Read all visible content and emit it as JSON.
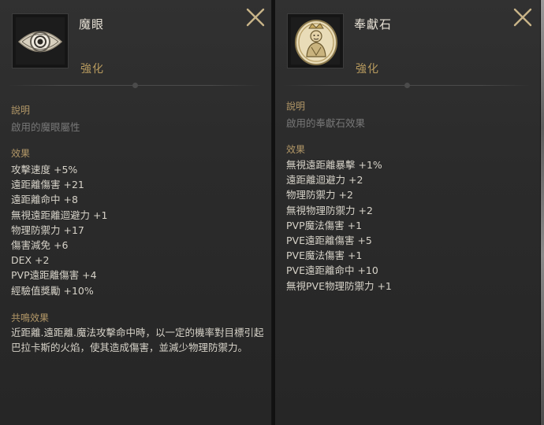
{
  "left_panel": {
    "name": "魔眼",
    "enhance_label": "強化",
    "description_heading": "說明",
    "description_text": "啟用的魔眼屬性",
    "effects_heading": "效果",
    "effects": [
      "攻擊速度 +5%",
      "遠距離傷害 +21",
      "遠距離命中 +8",
      "無視遠距離迴避力 +1",
      "物理防禦力 +17",
      "傷害減免 +6",
      "DEX +2",
      "PVP遠距離傷害 +4",
      "經驗值獎勵 +10%"
    ],
    "resonance_heading": "共鳴效果",
    "resonance_text": "近距離.遠距離.魔法攻擊命中時，以一定的機率對目標引起巴拉卡斯的火焰，使其造成傷害，並減少物理防禦力。",
    "icon": "demon-eye-icon"
  },
  "right_panel": {
    "name": "奉獻石",
    "enhance_label": "強化",
    "description_heading": "說明",
    "description_text": "啟用的奉獻石效果",
    "effects_heading": "效果",
    "effects": [
      "無視遠距離暴擊 +1%",
      "遠距離迴避力 +2",
      "物理防禦力 +2",
      "無視物理防禦力 +2",
      "PVP魔法傷害 +1",
      "PVE遠距離傷害 +5",
      "PVE魔法傷害 +1",
      "PVE遠距離命中 +10",
      "無視PVE物理防禦力 +1"
    ],
    "icon": "devotion-stone-icon"
  },
  "colors": {
    "panel_bg": "#2d2d2d",
    "heading": "#b39868",
    "enhance": "#b79a5e",
    "stat_text": "#d6d2c8",
    "muted_text": "#777777",
    "close_icon": "#c8b488"
  }
}
